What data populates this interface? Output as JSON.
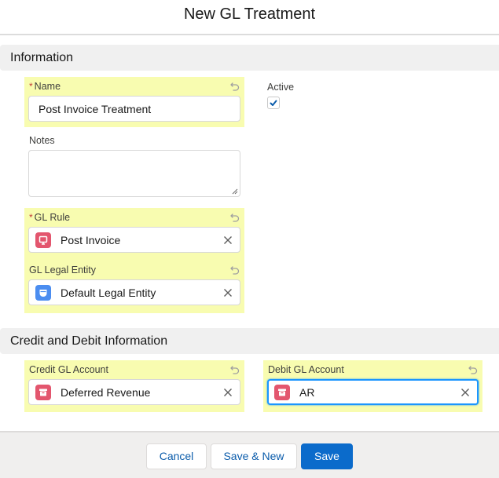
{
  "modal": {
    "title": "New GL Treatment"
  },
  "sections": {
    "information": {
      "title": "Information"
    },
    "credit_debit": {
      "title": "Credit and Debit Information"
    }
  },
  "fields": {
    "name": {
      "label": "Name",
      "required": true,
      "value": "Post Invoice Treatment"
    },
    "active": {
      "label": "Active",
      "checked": true
    },
    "notes": {
      "label": "Notes",
      "value": ""
    },
    "gl_rule": {
      "label": "GL Rule",
      "required": true,
      "value": "Post Invoice",
      "icon": "screen-icon",
      "icon_color": "#e3566e"
    },
    "gl_legal_entity": {
      "label": "GL Legal Entity",
      "value": "Default Legal Entity",
      "icon": "shield-icon",
      "icon_color": "#4b8df0"
    },
    "credit_gl_account": {
      "label": "Credit GL Account",
      "value": "Deferred Revenue",
      "icon": "archive-icon",
      "icon_color": "#e3566e"
    },
    "debit_gl_account": {
      "label": "Debit GL Account",
      "value": "AR",
      "icon": "archive-icon",
      "icon_color": "#e3566e",
      "focused": true
    }
  },
  "required_marker": "*",
  "footer": {
    "cancel_label": "Cancel",
    "save_new_label": "Save & New",
    "save_label": "Save"
  },
  "colors": {
    "highlight": "#f8fcb0",
    "brand": "#0b6bcb",
    "link": "#0b5cab",
    "required": "#c23934",
    "focus": "#1b96ff"
  }
}
